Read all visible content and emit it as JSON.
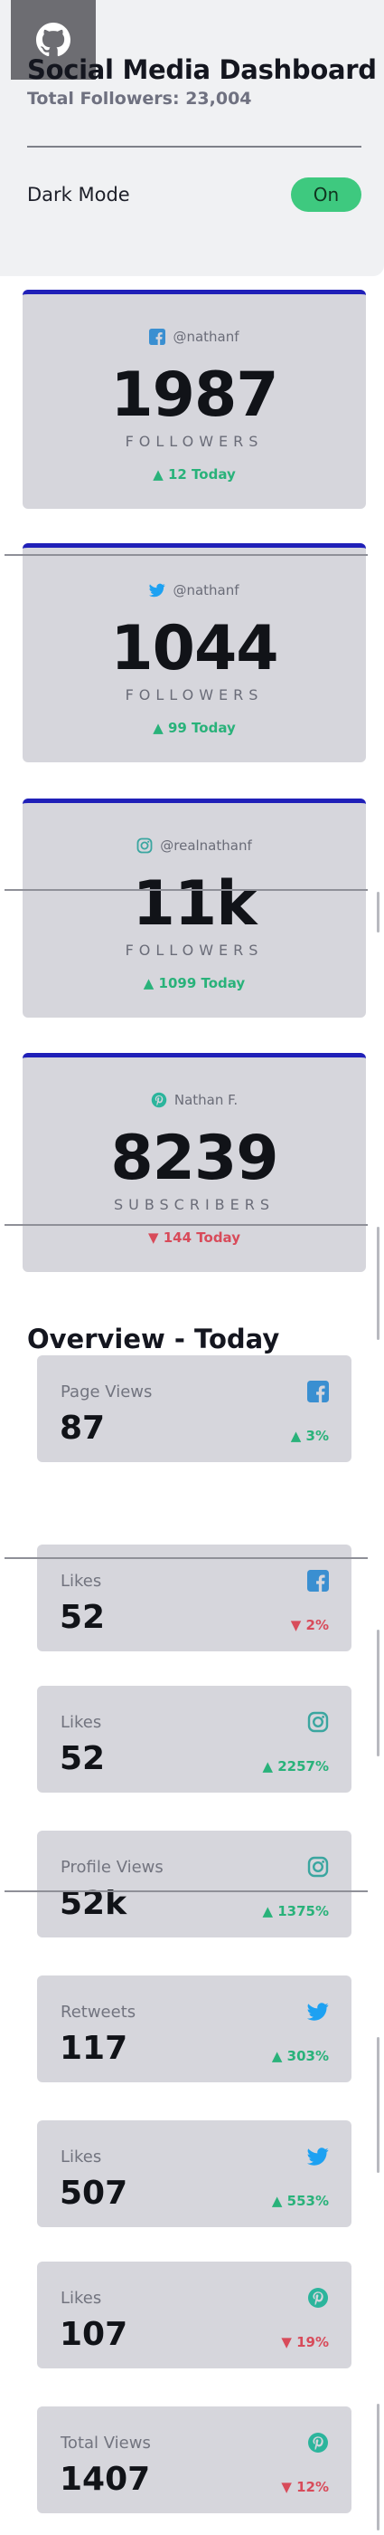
{
  "header": {
    "title": "Social Media Dashboard",
    "total_followers": "Total Followers: 23,004",
    "dark_mode_label": "Dark Mode",
    "toggle_label": "On"
  },
  "follower_cards": [
    {
      "platform": "facebook",
      "handle": "@nathanf",
      "count": "1987",
      "kind": "FOLLOWERS",
      "delta": "▲ 12 Today",
      "direction": "up"
    },
    {
      "platform": "twitter",
      "handle": "@nathanf",
      "count": "1044",
      "kind": "FOLLOWERS",
      "delta": "▲ 99 Today",
      "direction": "up"
    },
    {
      "platform": "instagram",
      "handle": "@realnathanf",
      "count": "11k",
      "kind": "FOLLOWERS",
      "delta": "▲ 1099 Today",
      "direction": "up"
    },
    {
      "platform": "pinterest",
      "handle": "Nathan F.",
      "count": "8239",
      "kind": "SUBSCRIBERS",
      "delta": "▼ 144 Today",
      "direction": "down"
    }
  ],
  "overview": {
    "title": "Overview - Today",
    "cards": [
      {
        "label": "Page Views",
        "value": "87",
        "platform": "facebook",
        "pct": "▲ 3%",
        "direction": "up"
      },
      {
        "label": "Likes",
        "value": "52",
        "platform": "facebook",
        "pct": "▼ 2%",
        "direction": "down"
      },
      {
        "label": "Likes",
        "value": "52",
        "platform": "instagram",
        "pct": "▲ 2257%",
        "direction": "up"
      },
      {
        "label": "Profile Views",
        "value": "52k",
        "platform": "instagram",
        "pct": "▲ 1375%",
        "direction": "up"
      },
      {
        "label": "Retweets",
        "value": "117",
        "platform": "twitter",
        "pct": "▲ 303%",
        "direction": "up"
      },
      {
        "label": "Likes",
        "value": "507",
        "platform": "twitter",
        "pct": "▲ 553%",
        "direction": "up"
      },
      {
        "label": "Likes",
        "value": "107",
        "platform": "pinterest",
        "pct": "▼ 19%",
        "direction": "down"
      },
      {
        "label": "Total Views",
        "value": "1407",
        "platform": "pinterest",
        "pct": "▼ 12%",
        "direction": "down"
      }
    ]
  },
  "colors": {
    "up": "#29b27a",
    "down": "#d84b5a",
    "card_top_border": "#2020b8",
    "toggle_on": "#3ec97f",
    "facebook": "#3a8fd1",
    "twitter": "#1da1f2",
    "instagram": "#3aa6a0",
    "pinterest": "#2bb59c"
  },
  "icons": {
    "github": "github-icon",
    "facebook": "facebook-icon",
    "twitter": "twitter-icon",
    "instagram": "instagram-icon",
    "pinterest": "pinterest-icon"
  }
}
